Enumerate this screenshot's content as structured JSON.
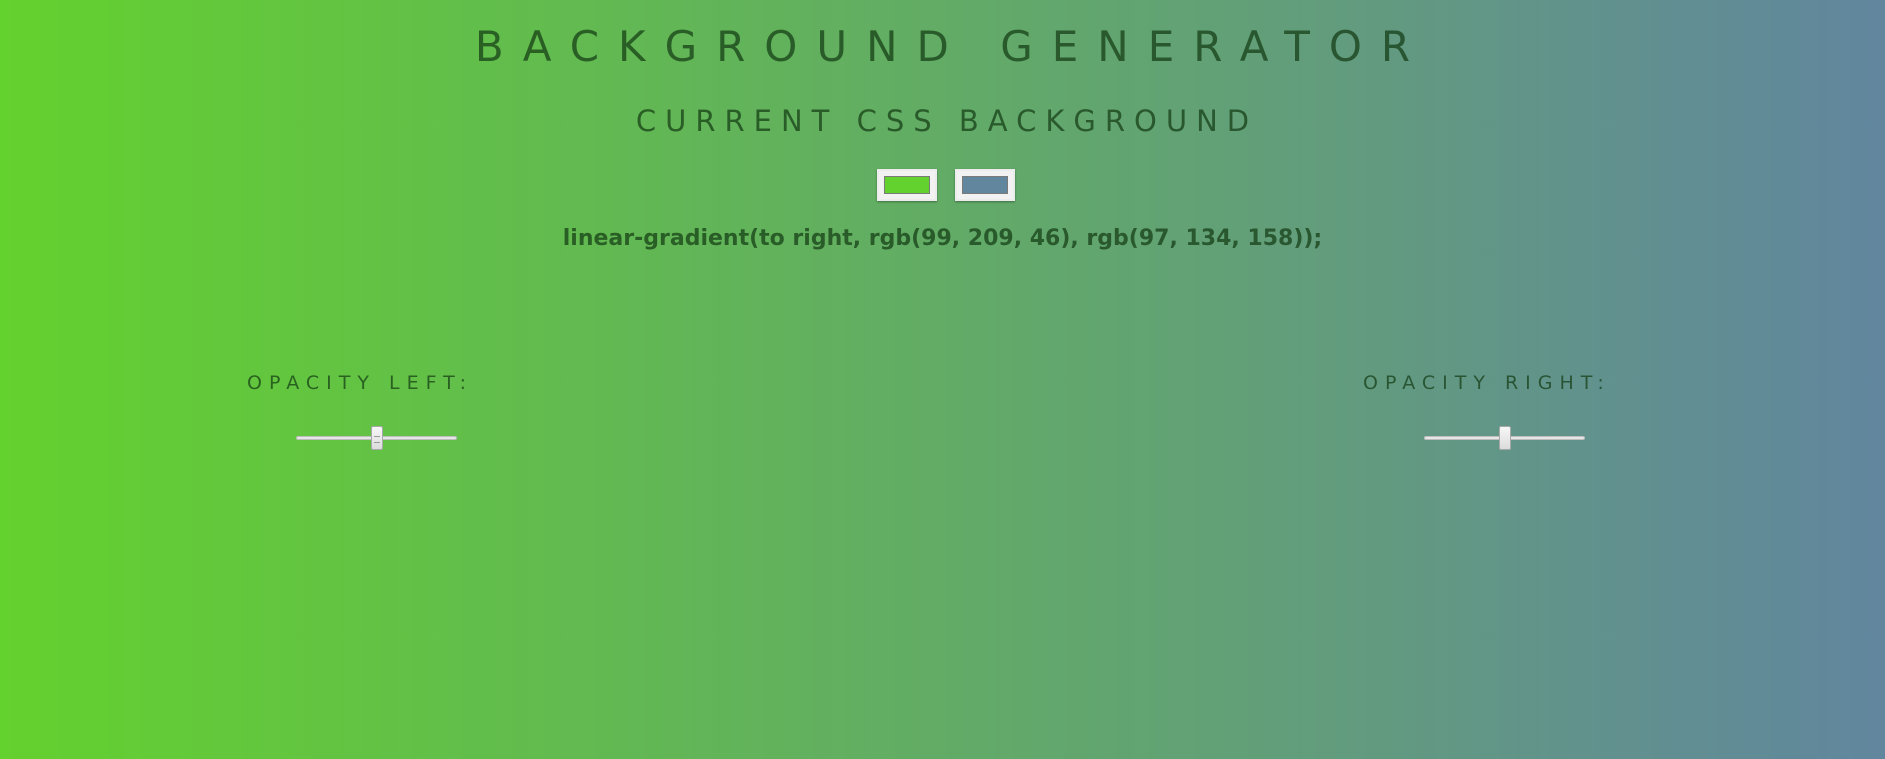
{
  "title": "BACKGROUND GENERATOR",
  "subtitle": "CURRENT CSS BACKGROUND",
  "colors": {
    "left": "#63d12e",
    "right": "#61869e"
  },
  "css_output": "linear-gradient(to right, rgb(99, 209, 46), rgb(97, 134, 158));",
  "controls": {
    "opacity_left_label": "OPACITY LEFT:",
    "opacity_right_label": "OPACITY RIGHT:",
    "opacity_left_value": 0.5,
    "opacity_right_value": 0.5
  }
}
